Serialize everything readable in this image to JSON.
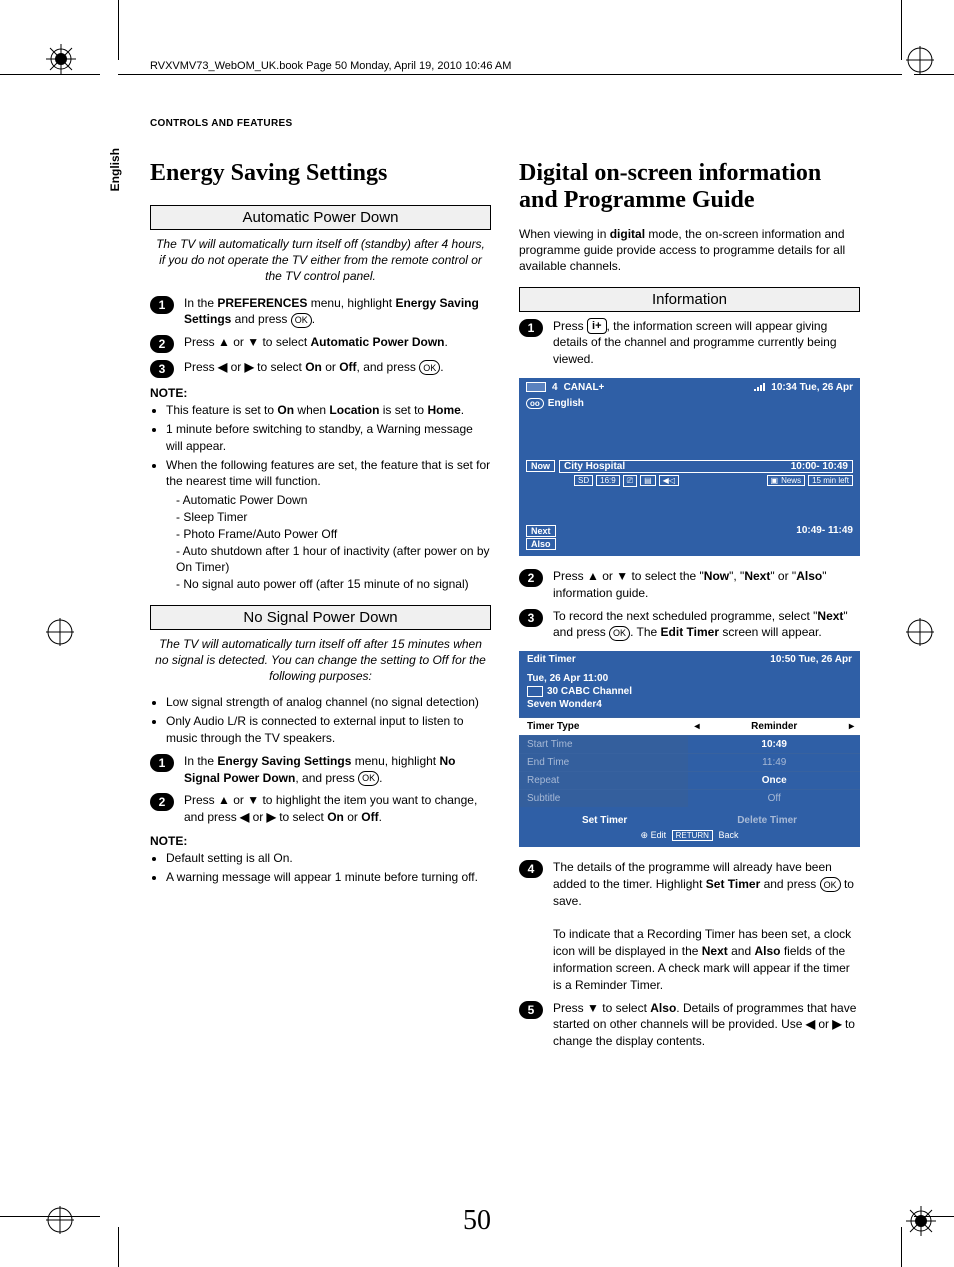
{
  "meta": {
    "book_line": "RVXVMV73_WebOM_UK.book  Page 50  Monday, April 19, 2010  10:46 AM",
    "section_header": "CONTROLS AND FEATURES",
    "side_tab": "English",
    "page_number": "50"
  },
  "left": {
    "title": "Energy Saving Settings",
    "apd": {
      "heading": "Automatic Power Down",
      "intro": "The TV will automatically turn itself off (standby) after 4 hours, if you do not operate the TV either from the remote control or the TV control panel.",
      "step1_a": "In the ",
      "step1_b": "PREFERENCES",
      "step1_c": " menu, highlight ",
      "step1_d": "Energy Saving Settings",
      "step1_e": " and press ",
      "step2_a": "Press ",
      "step2_b": " or ",
      "step2_c": " to select ",
      "step2_d": "Automatic Power Down",
      "step2_e": ".",
      "step3_a": "Press ",
      "step3_b": " or ",
      "step3_c": " to select ",
      "step3_d": "On",
      "step3_e": " or ",
      "step3_f": "Off",
      "step3_g": ", and press ",
      "note_label": "NOTE:",
      "notes": {
        "n1_a": "This feature is set to ",
        "n1_b": "On",
        "n1_c": " when ",
        "n1_d": "Location",
        "n1_e": " is set to ",
        "n1_f": "Home",
        "n1_g": ".",
        "n2": "1 minute before switching to standby, a Warning message will appear.",
        "n3": "When the following features are set, the feature that is set for the nearest time will function.",
        "sub": [
          "Automatic Power Down",
          "Sleep Timer",
          "Photo Frame/Auto Power Off",
          "Auto shutdown after 1 hour of inactivity (after power on by On Timer)",
          "No signal auto power off (after 15 minute of no signal)"
        ]
      }
    },
    "nspd": {
      "heading": "No Signal Power Down",
      "intro": "The TV will automatically turn itself off after 15 minutes when no signal is detected. You can change the setting to Off for the following purposes:",
      "bullets": [
        "Low signal strength of analog channel (no signal detection)",
        "Only Audio L/R is connected to external input to listen to music through the TV speakers."
      ],
      "step1_a": "In the ",
      "step1_b": "Energy Saving Settings",
      "step1_c": " menu, highlight ",
      "step1_d": "No Signal Power Down",
      "step1_e": ", and press ",
      "step2_a": "Press ",
      "step2_b": " or ",
      "step2_c": " to highlight the item you want to change, and press ",
      "step2_d": " or ",
      "step2_e": " to select ",
      "step2_f": "On",
      "step2_g": " or ",
      "step2_h": "Off",
      "step2_i": ".",
      "note_label": "NOTE:",
      "notes": [
        "Default setting is all On.",
        "A warning message will appear 1 minute before turning off."
      ]
    }
  },
  "right": {
    "title": "Digital on-screen information and Programme Guide",
    "intro_a": "When viewing in ",
    "intro_b": "digital",
    "intro_c": " mode, the on-screen information and programme guide provide access to programme details for all available channels.",
    "info_heading": "Information",
    "step1_a": "Press ",
    "step1_b": ", the information screen will appear giving details of the channel and programme currently being viewed.",
    "panel": {
      "ch_num": "4",
      "ch_name": "CANAL+",
      "clock": "10:34 Tue, 26 Apr",
      "lang": "English",
      "now_label": "Now",
      "now_prog": "City Hospital",
      "now_time": "10:00- 10:49",
      "sd": "SD",
      "ratio": "16:9",
      "news": "News",
      "mins": "15 min left",
      "next_label": "Next",
      "next_time": "10:49- 11:49",
      "also_label": "Also"
    },
    "step2_a": "Press ",
    "step2_b": " or ",
    "step2_c": " to select the \"",
    "step2_d": "Now",
    "step2_e": "\", \"",
    "step2_f": "Next",
    "step2_g": "\" or \"",
    "step2_h": "Also",
    "step2_i": "\" information guide.",
    "step3_a": "To record the next scheduled programme, select \"",
    "step3_b": "Next",
    "step3_c": "\" and press ",
    "step3_d": ". The ",
    "step3_e": "Edit Timer",
    "step3_f": " screen will appear.",
    "timer": {
      "title": "Edit Timer",
      "ts": "10:50 Tue, 26 Apr",
      "meta_time": "Tue, 26 Apr 11:00",
      "meta_ch": "30 CABC Channel",
      "meta_prog": "Seven Wonder4",
      "rows": {
        "type_l": "Timer Type",
        "type_v": "Reminder",
        "start_l": "Start Time",
        "start_v": "10:49",
        "end_l": "End Time",
        "end_v": "11:49",
        "rep_l": "Repeat",
        "rep_v": "Once",
        "sub_l": "Subtitle",
        "sub_v": "Off"
      },
      "set": "Set Timer",
      "del": "Delete Timer",
      "foot_edit": "Edit",
      "foot_ret": "RETURN",
      "foot_back": "Back"
    },
    "step4_a": "The details of the programme will already have been added to the timer. Highlight ",
    "step4_b": "Set Timer",
    "step4_c": " and press ",
    "step4_d": " to save.",
    "step4_p2_a": "To indicate that a Recording Timer has been set, a clock icon will be displayed in the ",
    "step4_p2_b": "Next",
    "step4_p2_c": " and ",
    "step4_p2_d": "Also",
    "step4_p2_e": " fields of the information screen. A check mark will appear if the timer is a Reminder Timer.",
    "step5_a": "Press ",
    "step5_b": " to select ",
    "step5_c": "Also",
    "step5_d": ". Details of programmes that have started on other channels will be provided. Use ",
    "step5_e": " or ",
    "step5_f": " to change the display contents."
  },
  "glyph": {
    "ok": "OK",
    "info": "i+",
    "up": "▲",
    "down": "▼",
    "left": "◀",
    "right": "▶",
    "tl": "◂",
    "tr": "▸"
  }
}
